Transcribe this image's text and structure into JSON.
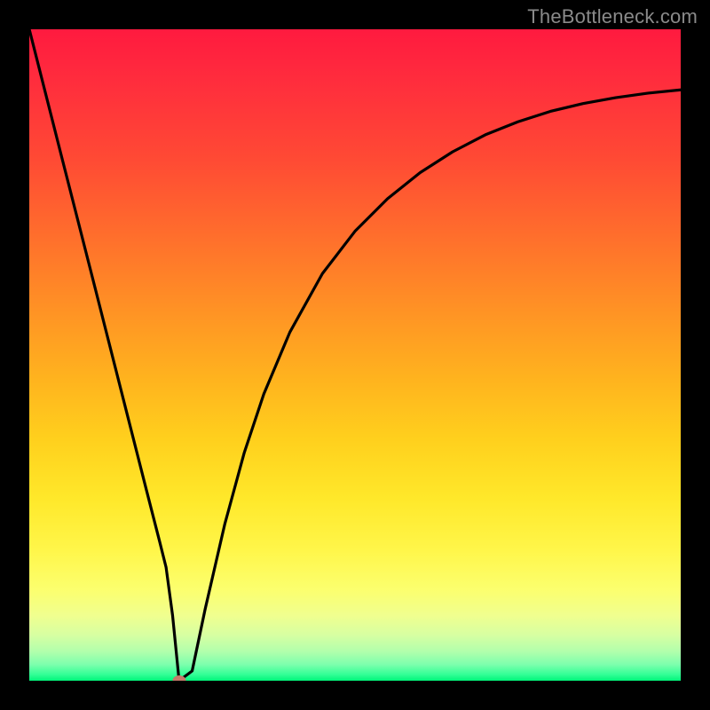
{
  "watermark": "TheBottleneck.com",
  "chart_data": {
    "type": "line",
    "title": "",
    "xlabel": "",
    "ylabel": "",
    "xlim": [
      0,
      100
    ],
    "ylim": [
      0,
      100
    ],
    "grid": false,
    "series": [
      {
        "name": "bottleneck-curve",
        "x": [
          0,
          5,
          10,
          15,
          18,
          20,
          21,
          22,
          23,
          25,
          27,
          30,
          33,
          36,
          40,
          45,
          50,
          55,
          60,
          65,
          70,
          75,
          80,
          85,
          90,
          95,
          100
        ],
        "y": [
          100,
          80.3,
          60.7,
          41.0,
          29.2,
          21.4,
          17.4,
          10.0,
          0,
          1.5,
          11.0,
          24.0,
          35.0,
          44.0,
          53.5,
          62.5,
          69.0,
          74.0,
          78.0,
          81.2,
          83.8,
          85.8,
          87.4,
          88.6,
          89.5,
          90.2,
          90.7
        ]
      }
    ],
    "marker": {
      "x": 23,
      "y": 0,
      "name": "optimal-point"
    },
    "background_gradient": {
      "top": "#ff1a3f",
      "mid": "#ffd01d",
      "bottom": "#00f57a"
    }
  }
}
